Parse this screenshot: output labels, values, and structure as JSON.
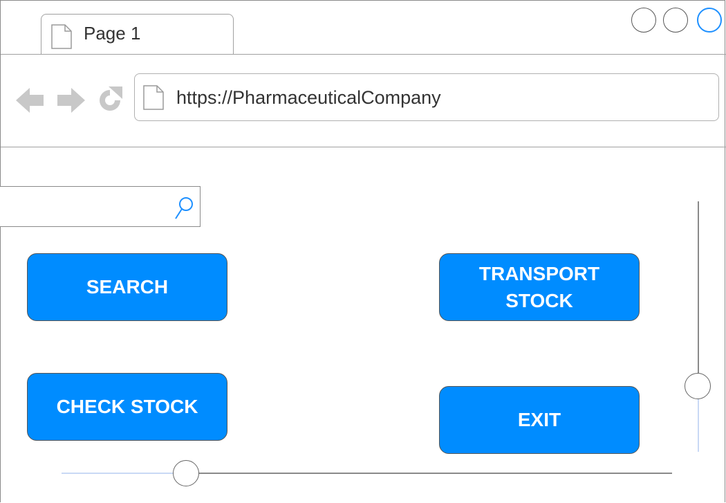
{
  "browser": {
    "tab": {
      "label": "Page 1",
      "icon": "page-icon"
    },
    "window_controls": [
      "minimize",
      "maximize",
      "close"
    ],
    "nav": {
      "back_icon": "back-arrow-icon",
      "forward_icon": "forward-arrow-icon",
      "reload_icon": "reload-icon"
    },
    "url": "https://PharmaceuticalCompany"
  },
  "search": {
    "value": "",
    "icon": "search-icon"
  },
  "buttons": {
    "search": "SEARCH",
    "transport_stock": "TRANSPORT\nSTOCK",
    "check_stock": "CHECK STOCK",
    "exit": "EXIT"
  },
  "colors": {
    "button_bg": "#008cff",
    "button_text": "#ffffff",
    "accent": "#1e90ff"
  }
}
